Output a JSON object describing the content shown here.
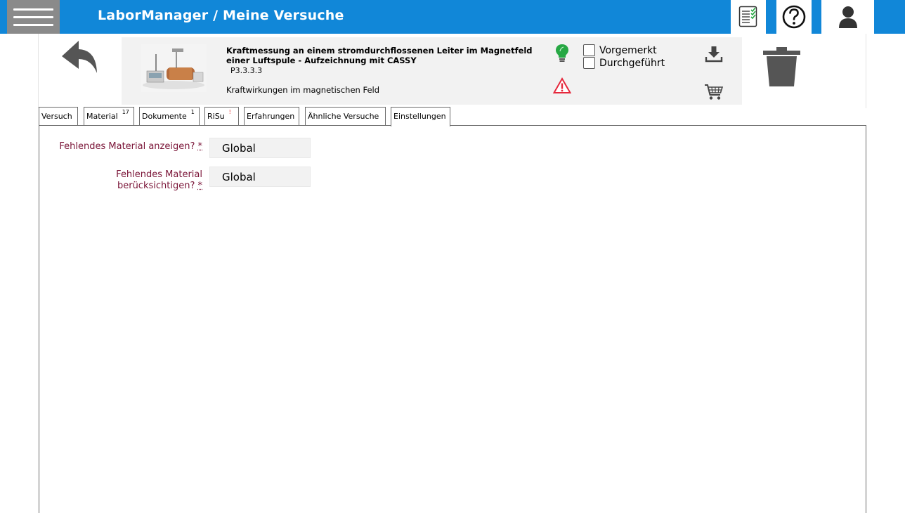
{
  "app": {
    "title": "LaborManager /  Meine Versuche"
  },
  "experiment": {
    "title": "Kraftmessung an einem stromdurchflossenen Leiter im Magnetfeld einer Luftspule - Aufzeichnung mit CASSY",
    "code": "P3.3.3.3",
    "category": "Kraftwirkungen im magnetischen Feld",
    "checkbox_vorgemerkt": "Vorgemerkt",
    "checkbox_durchgefuehrt": "Durchgeführt"
  },
  "tabs": [
    {
      "label": "Versuch",
      "badge": ""
    },
    {
      "label": "Material",
      "badge": "17"
    },
    {
      "label": "Dokumente",
      "badge": "1"
    },
    {
      "label": "RiSu",
      "badge": "!"
    },
    {
      "label": "Erfahrungen",
      "badge": ""
    },
    {
      "label": "Ähnliche  Versuche",
      "badge": ""
    },
    {
      "label": "Einstellungen",
      "badge": ""
    }
  ],
  "settings": {
    "field1_label": "Fehlendes  Material  anzeigen?",
    "field1_value": "Global",
    "field2_label_line1": "Fehlendes  Material",
    "field2_label_line2": "berücksichtigen?",
    "field2_value": "Global",
    "required_mark": "*"
  },
  "colors": {
    "topbar": "#1187d8",
    "label": "#7a1437",
    "bulb": "#27a844",
    "warning": "#e5283c"
  }
}
